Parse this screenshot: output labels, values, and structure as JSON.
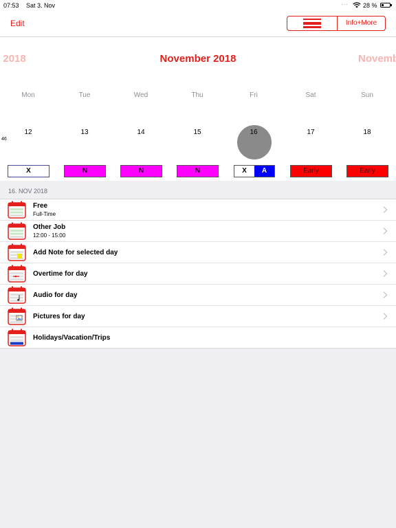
{
  "status_bar": {
    "time": "07:53",
    "date": "Sat 3. Nov",
    "battery": "28 %"
  },
  "nav": {
    "edit_label": "Edit",
    "info_label": "Info+More"
  },
  "calendar": {
    "prev_month": "er 2018",
    "current_month": "November 2018",
    "next_month": "Novemb",
    "weekdays": [
      "Mon",
      "Tue",
      "Wed",
      "Thu",
      "Fri",
      "Sat",
      "Sun"
    ],
    "week_number": "46",
    "days": [
      "12",
      "13",
      "14",
      "15",
      "16",
      "17",
      "18"
    ],
    "selected_day": "16",
    "shifts": {
      "mon": "X",
      "tue": "N",
      "wed": "N",
      "thu": "N",
      "fri_left": "X",
      "fri_right": "A",
      "sat": "Early",
      "sun": "Early"
    },
    "colors": {
      "accent": "#e3201b",
      "night": "#ff00ff",
      "early": "#ff0000",
      "a_shift": "#0000ff"
    }
  },
  "details": {
    "section_header": "16. NOV 2018",
    "rows": [
      {
        "title": "Free",
        "subtitle": "Full-Time"
      },
      {
        "title": "Other Job",
        "subtitle": "12:00 - 15:00"
      },
      {
        "title": "Add Note for selected day"
      },
      {
        "title": "Overtime for day"
      },
      {
        "title": "Audio for day"
      },
      {
        "title": "Pictures for day"
      },
      {
        "title": "Holidays/Vacation/Trips"
      }
    ]
  }
}
